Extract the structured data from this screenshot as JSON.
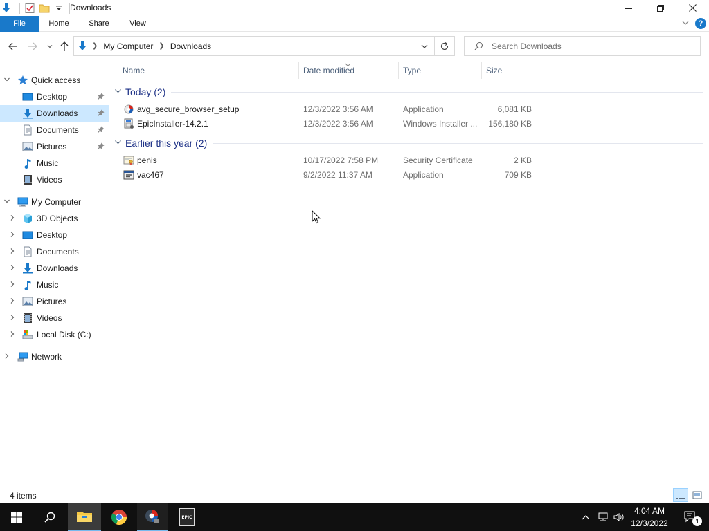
{
  "window": {
    "title": "Downloads"
  },
  "ribbon": {
    "tabs": [
      "File",
      "Home",
      "Share",
      "View"
    ],
    "help_label": "?"
  },
  "address": {
    "crumbs": [
      "My Computer",
      "Downloads"
    ],
    "search_placeholder": "Search Downloads"
  },
  "navpane": {
    "quick_access": {
      "label": "Quick access",
      "items": [
        {
          "label": "Desktop",
          "icon": "desktop-icon",
          "pinned": true
        },
        {
          "label": "Downloads",
          "icon": "downloads-icon",
          "pinned": true,
          "selected": true
        },
        {
          "label": "Documents",
          "icon": "documents-icon",
          "pinned": true
        },
        {
          "label": "Pictures",
          "icon": "pictures-icon",
          "pinned": true
        },
        {
          "label": "Music",
          "icon": "music-icon"
        },
        {
          "label": "Videos",
          "icon": "videos-icon"
        }
      ]
    },
    "my_computer": {
      "label": "My Computer",
      "items": [
        {
          "label": "3D Objects",
          "icon": "3d-objects-icon"
        },
        {
          "label": "Desktop",
          "icon": "desktop-icon"
        },
        {
          "label": "Documents",
          "icon": "documents-icon"
        },
        {
          "label": "Downloads",
          "icon": "downloads-icon"
        },
        {
          "label": "Music",
          "icon": "music-icon"
        },
        {
          "label": "Pictures",
          "icon": "pictures-icon"
        },
        {
          "label": "Videos",
          "icon": "videos-icon"
        },
        {
          "label": "Local Disk (C:)",
          "icon": "local-disk-icon"
        }
      ]
    },
    "network": {
      "label": "Network"
    }
  },
  "columns": {
    "name": "Name",
    "date": "Date modified",
    "type": "Type",
    "size": "Size"
  },
  "groups": [
    {
      "label": "Today (2)",
      "files": [
        {
          "name": "avg_secure_browser_setup",
          "date": "12/3/2022 3:56 AM",
          "type": "Application",
          "size": "6,081 KB",
          "icon": "avg-installer-icon"
        },
        {
          "name": "EpicInstaller-14.2.1",
          "date": "12/3/2022 3:56 AM",
          "type": "Windows Installer ...",
          "size": "156,180 KB",
          "icon": "msi-package-icon"
        }
      ]
    },
    {
      "label": "Earlier this year (2)",
      "files": [
        {
          "name": "penis",
          "date": "10/17/2022 7:58 PM",
          "type": "Security Certificate",
          "size": "2 KB",
          "icon": "certificate-icon"
        },
        {
          "name": "vac467",
          "date": "9/2/2022 11:37 AM",
          "type": "Application",
          "size": "709 KB",
          "icon": "application-icon"
        }
      ]
    }
  ],
  "status": {
    "item_count": "4 items"
  },
  "taskbar": {
    "time": "4:04 AM",
    "date": "12/3/2022",
    "notification_count": "1",
    "epic_label": "EPIC"
  },
  "colors": {
    "accent": "#1979ca",
    "selection": "#cce8ff",
    "group_header": "#1e3287",
    "taskbar": "#101010"
  }
}
